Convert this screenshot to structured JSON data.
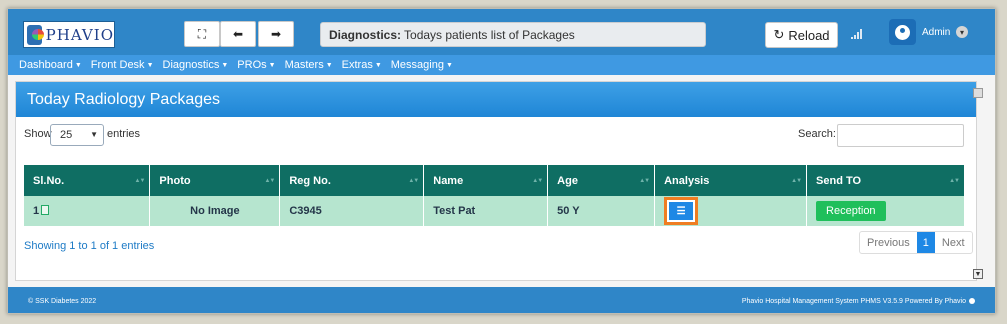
{
  "header": {
    "logo_text": "PHAVIO",
    "search_prefix": "Diagnostics:",
    "search_text": "Todays patients list of Packages",
    "reload_label": "Reload",
    "user_name": "Admin"
  },
  "menu": [
    {
      "label": "Dashboard"
    },
    {
      "label": "Front Desk"
    },
    {
      "label": "Diagnostics"
    },
    {
      "label": "PROs"
    },
    {
      "label": "Masters"
    },
    {
      "label": "Extras"
    },
    {
      "label": "Messaging"
    }
  ],
  "panel": {
    "title": "Today Radiology Packages",
    "show_label": "Show",
    "entries_value": "25",
    "entries_label": "entries",
    "search_label": "Search:"
  },
  "table": {
    "headers": [
      "Sl.No.",
      "Photo",
      "Reg No.",
      "Name",
      "Age",
      "Analysis",
      "Send TO"
    ],
    "rows": [
      {
        "slno": "1",
        "photo": "No Image",
        "regno": "C3945",
        "name": "Test Pat",
        "age": "50 Y",
        "send_to": "Reception"
      }
    ]
  },
  "pagination": {
    "info": "Showing 1 to 1 of 1 entries",
    "previous": "Previous",
    "current": "1",
    "next": "Next"
  },
  "footer": {
    "left": "© SSK Diabetes 2022",
    "right_prefix": "Phavio Hospital Management System PHMS V3.5.9 Powered By",
    "right_brand": "Phavio"
  }
}
